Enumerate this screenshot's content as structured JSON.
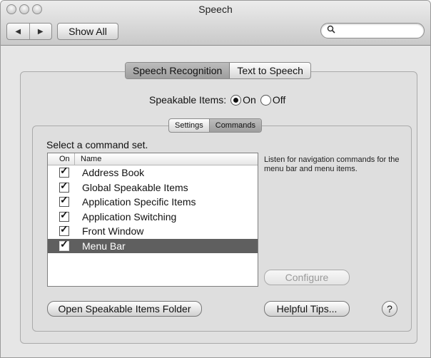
{
  "window": {
    "title": "Speech"
  },
  "toolbar": {
    "back_glyph": "◀",
    "forward_glyph": "▶",
    "show_all_label": "Show All",
    "search_placeholder": ""
  },
  "tabs": [
    {
      "label": "Speech Recognition",
      "selected": true
    },
    {
      "label": "Text to Speech",
      "selected": false
    }
  ],
  "speakable_items": {
    "label": "Speakable Items:",
    "on_label": "On",
    "off_label": "Off",
    "value": "On"
  },
  "subtabs": [
    {
      "label": "Settings",
      "selected": false
    },
    {
      "label": "Commands",
      "selected": true
    }
  ],
  "commands": {
    "heading": "Select a command set.",
    "columns": {
      "on": "On",
      "name": "Name"
    },
    "rows": [
      {
        "name": "Address Book",
        "checked": true,
        "selected": false
      },
      {
        "name": "Global Speakable Items",
        "checked": true,
        "selected": false
      },
      {
        "name": "Application Specific Items",
        "checked": true,
        "selected": false
      },
      {
        "name": "Application Switching",
        "checked": true,
        "selected": false
      },
      {
        "name": "Front Window",
        "checked": true,
        "selected": false
      },
      {
        "name": "Menu Bar",
        "checked": true,
        "selected": true
      }
    ],
    "description": "Listen for navigation commands for the menu bar and menu items.",
    "configure_label": "Configure",
    "open_folder_label": "Open Speakable Items Folder",
    "helpful_tips_label": "Helpful Tips...",
    "help_glyph": "?"
  },
  "colors": {
    "selection": "#5f5f5f",
    "window_bg": "#e6e6e6"
  }
}
